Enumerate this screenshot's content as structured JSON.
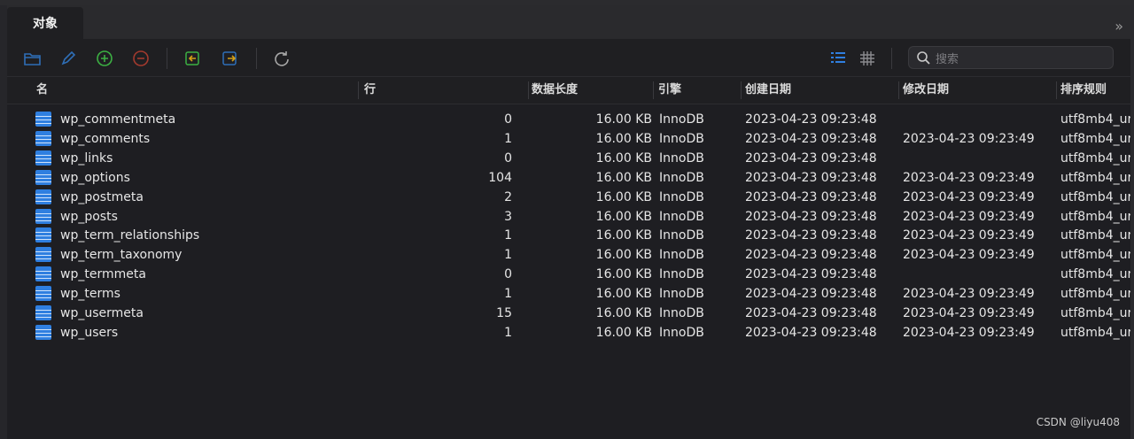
{
  "tab": {
    "label": "对象"
  },
  "search": {
    "placeholder": "搜索"
  },
  "columns": [
    "名",
    "行",
    "数据长度",
    "引擎",
    "创建日期",
    "修改日期",
    "排序规则"
  ],
  "rows": [
    {
      "name": "wp_commentmeta",
      "rows": "0",
      "size": "16.00 KB",
      "engine": "InnoDB",
      "created": "2023-04-23 09:23:48",
      "modified": "",
      "collation": "utf8mb4_ur"
    },
    {
      "name": "wp_comments",
      "rows": "1",
      "size": "16.00 KB",
      "engine": "InnoDB",
      "created": "2023-04-23 09:23:48",
      "modified": "2023-04-23 09:23:49",
      "collation": "utf8mb4_ur"
    },
    {
      "name": "wp_links",
      "rows": "0",
      "size": "16.00 KB",
      "engine": "InnoDB",
      "created": "2023-04-23 09:23:48",
      "modified": "",
      "collation": "utf8mb4_ur"
    },
    {
      "name": "wp_options",
      "rows": "104",
      "size": "16.00 KB",
      "engine": "InnoDB",
      "created": "2023-04-23 09:23:48",
      "modified": "2023-04-23 09:23:49",
      "collation": "utf8mb4_ur"
    },
    {
      "name": "wp_postmeta",
      "rows": "2",
      "size": "16.00 KB",
      "engine": "InnoDB",
      "created": "2023-04-23 09:23:48",
      "modified": "2023-04-23 09:23:49",
      "collation": "utf8mb4_ur"
    },
    {
      "name": "wp_posts",
      "rows": "3",
      "size": "16.00 KB",
      "engine": "InnoDB",
      "created": "2023-04-23 09:23:48",
      "modified": "2023-04-23 09:23:49",
      "collation": "utf8mb4_ur"
    },
    {
      "name": "wp_term_relationships",
      "rows": "1",
      "size": "16.00 KB",
      "engine": "InnoDB",
      "created": "2023-04-23 09:23:48",
      "modified": "2023-04-23 09:23:49",
      "collation": "utf8mb4_ur"
    },
    {
      "name": "wp_term_taxonomy",
      "rows": "1",
      "size": "16.00 KB",
      "engine": "InnoDB",
      "created": "2023-04-23 09:23:48",
      "modified": "2023-04-23 09:23:49",
      "collation": "utf8mb4_ur"
    },
    {
      "name": "wp_termmeta",
      "rows": "0",
      "size": "16.00 KB",
      "engine": "InnoDB",
      "created": "2023-04-23 09:23:48",
      "modified": "",
      "collation": "utf8mb4_ur"
    },
    {
      "name": "wp_terms",
      "rows": "1",
      "size": "16.00 KB",
      "engine": "InnoDB",
      "created": "2023-04-23 09:23:48",
      "modified": "2023-04-23 09:23:49",
      "collation": "utf8mb4_ur"
    },
    {
      "name": "wp_usermeta",
      "rows": "15",
      "size": "16.00 KB",
      "engine": "InnoDB",
      "created": "2023-04-23 09:23:48",
      "modified": "2023-04-23 09:23:49",
      "collation": "utf8mb4_ur"
    },
    {
      "name": "wp_users",
      "rows": "1",
      "size": "16.00 KB",
      "engine": "InnoDB",
      "created": "2023-04-23 09:23:48",
      "modified": "2023-04-23 09:23:49",
      "collation": "utf8mb4_ur"
    }
  ],
  "watermark": "CSDN @liyu408",
  "icons": {
    "toolbar": [
      "open-folder-icon",
      "edit-pencil-icon",
      "add-circle-icon",
      "remove-circle-icon",
      "import-icon",
      "export-icon",
      "refresh-icon",
      "list-view-icon",
      "grid-view-icon",
      "search-icon",
      "double-chevron-right-icon"
    ],
    "row": "table-icon"
  },
  "colors": {
    "accent": "#2f7fe0",
    "add": "#3cb043",
    "remove": "#c0392b",
    "import_export": "#d4a017"
  }
}
